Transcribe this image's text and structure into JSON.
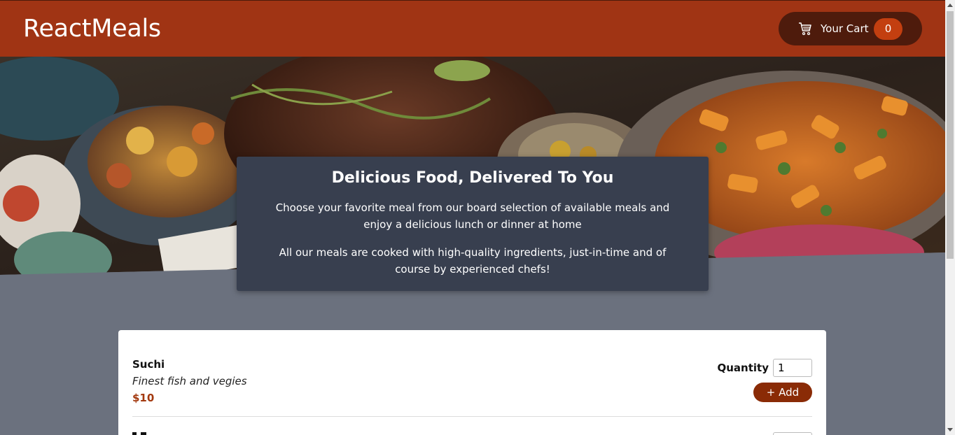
{
  "header": {
    "brand": "ReactMeals",
    "cart": {
      "label": "Your Cart",
      "count": "0",
      "icon": "cart-icon"
    }
  },
  "summary": {
    "title": "Delicious Food, Delivered To You",
    "paragraph1": "Choose your favorite meal from our board selection of available meals and enjoy a delicious lunch or dinner at home",
    "paragraph2": "All our meals are cooked with high-quality ingredients, just-in-time and of course by experienced chefs!"
  },
  "meals": [
    {
      "name": "Suchi",
      "description": "Finest fish and vegies",
      "price": "$10",
      "quantity_label": "Quantity",
      "quantity_value": "1",
      "add_label": "+ Add"
    }
  ],
  "colors": {
    "header": "#a03414",
    "cart_button": "#4e1b0c",
    "badge": "#c33f10",
    "summary_bg": "#383f4f",
    "page_bg": "#6b717e",
    "price": "#a3390f"
  }
}
